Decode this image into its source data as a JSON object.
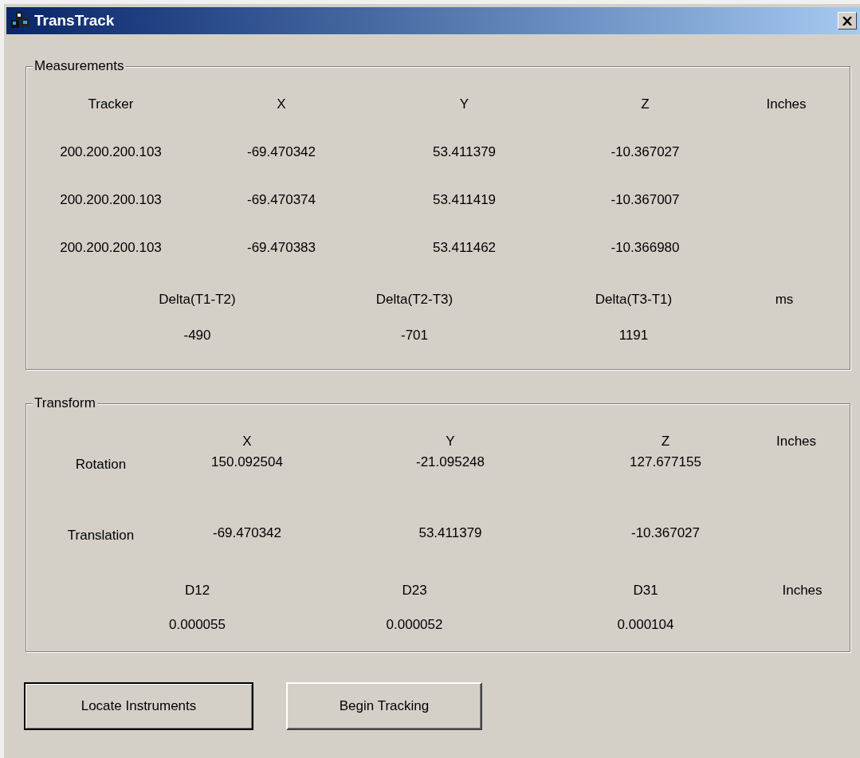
{
  "window": {
    "title": "TransTrack"
  },
  "measurements": {
    "title": "Measurements",
    "columns": [
      "Tracker",
      "X",
      "Y",
      "Z",
      "Inches"
    ],
    "rows": [
      [
        "200.200.200.103",
        "-69.470342",
        "53.411379",
        "-10.367027"
      ],
      [
        "200.200.200.103",
        "-69.470374",
        "53.411419",
        "-10.367007"
      ],
      [
        "200.200.200.103",
        "-69.470383",
        "53.411462",
        "-10.366980"
      ]
    ],
    "delta_columns": [
      "Delta(T1-T2)",
      "Delta(T2-T3)",
      "Delta(T3-T1)",
      "ms"
    ],
    "delta_values": [
      "-490",
      "-701",
      "1191"
    ]
  },
  "transform": {
    "title": "Transform",
    "columns": [
      "X",
      "Y",
      "Z",
      "Inches"
    ],
    "rows": [
      {
        "label": "Rotation",
        "values": [
          "150.092504",
          "-21.095248",
          "127.677155"
        ]
      },
      {
        "label": "Translation",
        "values": [
          "-69.470342",
          "53.411379",
          "-10.367027"
        ]
      }
    ],
    "distance_columns": [
      "D12",
      "D23",
      "D31",
      "Inches"
    ],
    "distance_values": [
      "0.000055",
      "0.000052",
      "0.000104"
    ]
  },
  "buttons": [
    {
      "label": "Locate Instruments",
      "default": true
    },
    {
      "label": "Begin Tracking",
      "default": false
    }
  ]
}
